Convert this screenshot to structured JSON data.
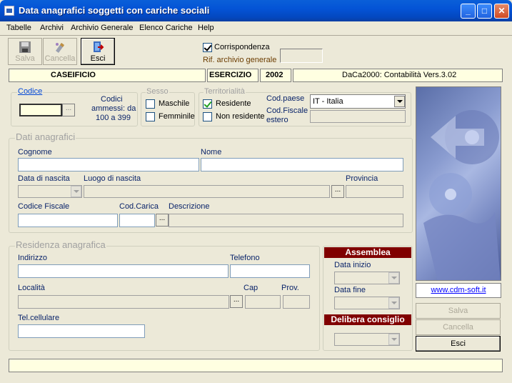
{
  "window": {
    "title": "Data anagrafici soggetti con cariche sociali"
  },
  "menu": [
    "Tabelle",
    "Archivi",
    "Archivio Generale",
    "Elenco Cariche",
    "Help"
  ],
  "toolbar": {
    "save": "Salva",
    "cancel": "Cancella",
    "exit": "Esci"
  },
  "correspondence": {
    "label": "Corrispondenza",
    "checked": true,
    "rif_label": "Rif. archivio generale",
    "rif_value": ""
  },
  "infobar": {
    "company": "CASEIFICIO",
    "year_label": "ESERCIZIO",
    "year": "2002",
    "app": "DaCa2000: Contabilità Vers.3.02"
  },
  "codice": {
    "title": "Codice",
    "value": "",
    "hint_1": "Codici",
    "hint_2": "ammessi: da",
    "hint_3": "100 a 399"
  },
  "sesso": {
    "title": "Sesso",
    "male": "Maschile",
    "female": "Femminile"
  },
  "territorialita": {
    "title": "Territorialità",
    "resident": "Residente",
    "non_resident": "Non residente",
    "resident_checked": true
  },
  "country": {
    "label": "Cod.paese",
    "value": "IT - Italia",
    "fiscal_label_1": "Cod.Fiscale",
    "fiscal_label_2": "estero",
    "fiscal_value": ""
  },
  "anagrafici": {
    "title": "Dati anagrafici",
    "surname": "Cognome",
    "name": "Nome",
    "birth_date": "Data di nascita",
    "birth_place": "Luogo di nascita",
    "province": "Provincia",
    "tax_code": "Codice Fiscale",
    "role_code": "Cod.Carica",
    "description": "Descrizione"
  },
  "residenza": {
    "title": "Residenza anagrafica",
    "address": "Indirizzo",
    "phone": "Telefono",
    "city": "Località",
    "zip": "Cap",
    "prov": "Prov.",
    "mobile": "Tel.cellulare"
  },
  "assemblea": {
    "title": "Assemblea",
    "start": "Data inizio",
    "end": "Data fine"
  },
  "delibera": {
    "title": "Delibera consiglio"
  },
  "link": "www.cdm-soft.it",
  "side": {
    "save": "Salva",
    "cancel": "Cancella",
    "exit": "Esci"
  }
}
